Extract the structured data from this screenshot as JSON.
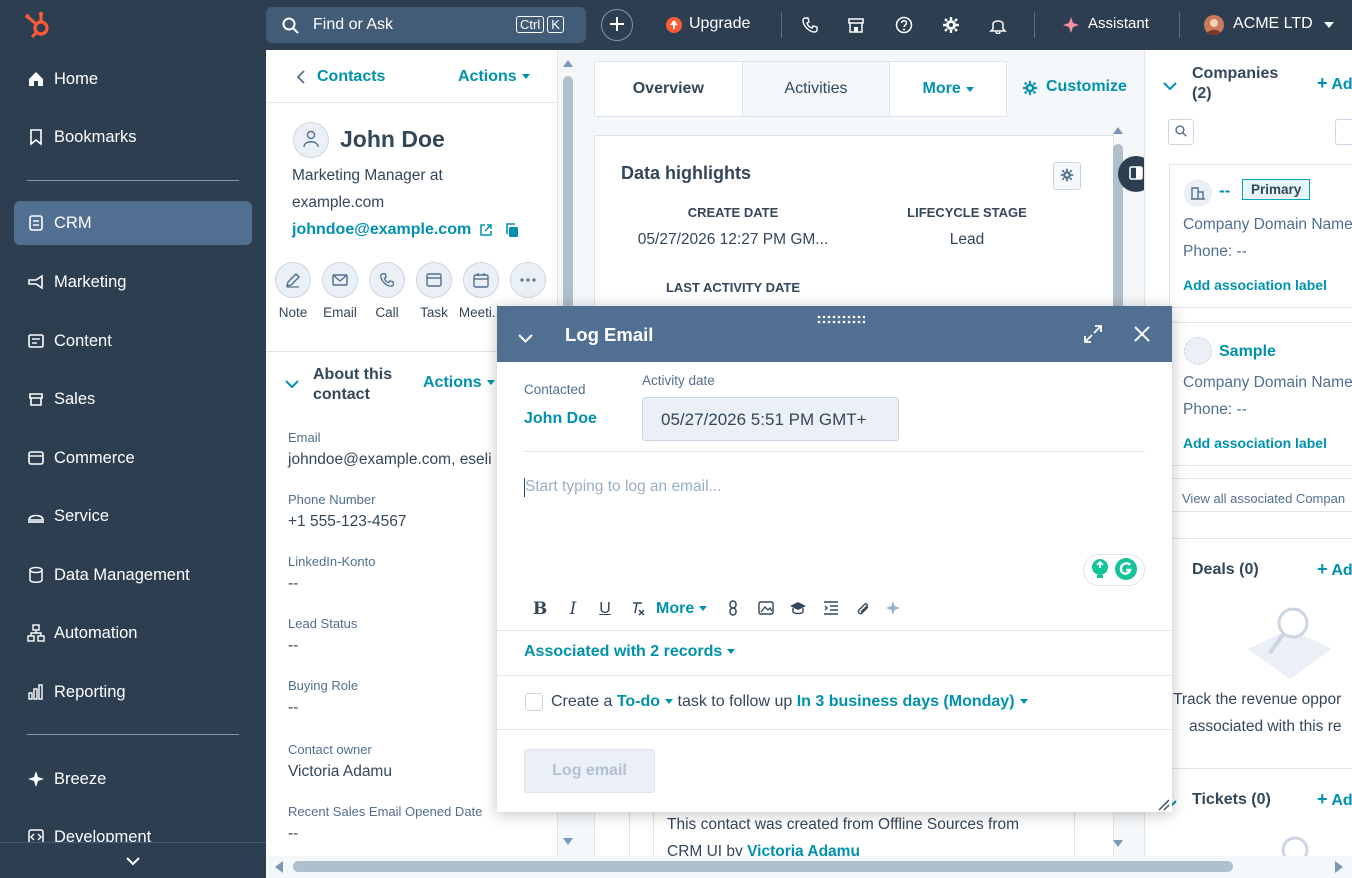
{
  "nav": {
    "items": [
      {
        "label": "Home",
        "icon": "home-icon"
      },
      {
        "label": "Bookmarks",
        "icon": "bookmark-icon"
      },
      {
        "label": "CRM",
        "icon": "crm-icon"
      },
      {
        "label": "Marketing",
        "icon": "megaphone-icon"
      },
      {
        "label": "Content",
        "icon": "content-icon"
      },
      {
        "label": "Sales",
        "icon": "sales-icon"
      },
      {
        "label": "Commerce",
        "icon": "commerce-icon"
      },
      {
        "label": "Service",
        "icon": "service-icon"
      },
      {
        "label": "Data Management",
        "icon": "database-icon"
      },
      {
        "label": "Automation",
        "icon": "automation-icon"
      },
      {
        "label": "Reporting",
        "icon": "reporting-icon"
      },
      {
        "label": "Breeze",
        "icon": "sparkle-icon"
      },
      {
        "label": "Development",
        "icon": "code-icon"
      }
    ],
    "active": "CRM"
  },
  "topbar": {
    "search_placeholder": "Find or Ask",
    "kbd_ctrl": "Ctrl",
    "kbd_k": "K",
    "upgrade": "Upgrade",
    "assistant": "Assistant",
    "account": "ACME LTD"
  },
  "contact": {
    "back_label": "Contacts",
    "actions_label": "Actions",
    "name": "John Doe",
    "title_line1": "Marketing Manager at",
    "title_line2": "example.com",
    "email": "johndoe@example.com",
    "activity_buttons": [
      "Note",
      "Email",
      "Call",
      "Task",
      "Meeti..."
    ],
    "about_title_line1": "About this",
    "about_title_line2": "contact",
    "about_actions": "Actions",
    "properties": [
      {
        "label": "Email",
        "value": "johndoe@example.com, eseli"
      },
      {
        "label": "Phone Number",
        "value": "+1 555-123-4567"
      },
      {
        "label": "LinkedIn-Konto",
        "value": "--"
      },
      {
        "label": "Lead Status",
        "value": "--"
      },
      {
        "label": "Buying Role",
        "value": "--"
      },
      {
        "label": "Contact owner",
        "value": "Victoria Adamu"
      },
      {
        "label": "Recent Sales Email Opened Date",
        "value": "--"
      }
    ]
  },
  "middle": {
    "tabs": [
      "Overview",
      "Activities",
      "More"
    ],
    "customize": "Customize",
    "highlights_title": "Data highlights",
    "create_date_label": "CREATE DATE",
    "create_date_value": "05/27/2026 12:27 PM GM...",
    "lifecycle_label": "LIFECYCLE STAGE",
    "lifecycle_value": "Lead",
    "last_activity_label": "LAST ACTIVITY DATE",
    "timeline_text_line1": "This contact was created from Offline Sources from",
    "timeline_text_line2_prefix": "CRM UI by ",
    "timeline_text_user": "Victoria Adamu"
  },
  "right": {
    "companies_title_line1": "Companies",
    "companies_title_line2": "(2)",
    "add_label": "Ad",
    "companies": [
      {
        "name": "--",
        "badge": "Primary",
        "domain": "Company Domain Name",
        "phone": "Phone: --",
        "assoc": "Add association label"
      },
      {
        "name": "Sample",
        "badge": "",
        "domain": "Company Domain Name",
        "phone": "Phone: --",
        "assoc": "Add association label"
      }
    ],
    "view_all": "View all associated Compan",
    "deals_title": "Deals (0)",
    "deals_text_line1": "Track the revenue oppor",
    "deals_text_line2": "associated with this re",
    "tickets_title": "Tickets (0)"
  },
  "modal": {
    "title": "Log Email",
    "contacted_label": "Contacted",
    "contacted_value": "John Doe",
    "activity_date_label": "Activity date",
    "activity_date_value": "05/27/2026 5:51 PM GMT+",
    "body_placeholder": "Start typing to log an email...",
    "toolbar_more": "More",
    "associated": "Associated with 2 records",
    "todo_prefix": "Create a",
    "todo_type": "To-do",
    "todo_middle": "task to follow up",
    "todo_when": "In 3 business days (Monday)",
    "log_button": "Log email"
  },
  "colors": {
    "nav_bg": "#2d3e50",
    "nav_active": "#516f90",
    "accent": "#0091ae",
    "modal_header": "#516f90",
    "hubspot_orange": "#ff5c35"
  }
}
